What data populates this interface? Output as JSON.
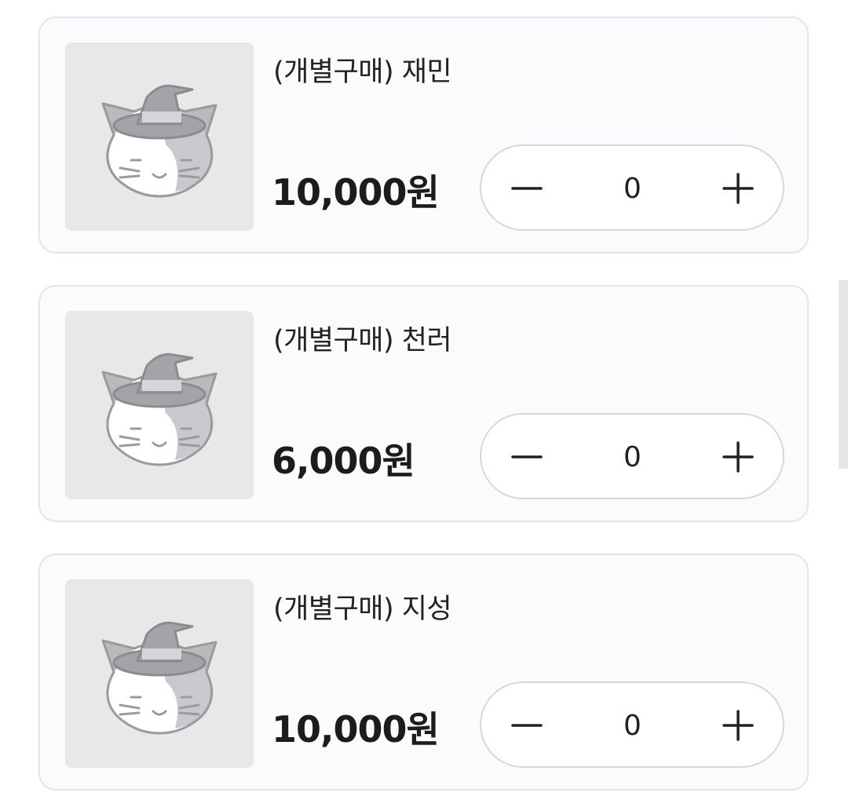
{
  "products": [
    {
      "title": "(개별구매) 재민",
      "price": "10,000원",
      "quantity": "0",
      "image_icon": "cat-witch-hat-icon"
    },
    {
      "title": "(개별구매) 천러",
      "price": "6,000원",
      "quantity": "0",
      "image_icon": "cat-witch-hat-icon"
    },
    {
      "title": "(개별구매) 지성",
      "price": "10,000원",
      "quantity": "0",
      "image_icon": "cat-witch-hat-icon"
    }
  ],
  "stepper": {
    "minus_icon": "minus-icon",
    "plus_icon": "plus-icon"
  },
  "colors": {
    "card_bg": "#fbfafc",
    "card_border": "#e6e4ea",
    "placeholder_bg": "#e8e8e8",
    "text": "#222222"
  }
}
